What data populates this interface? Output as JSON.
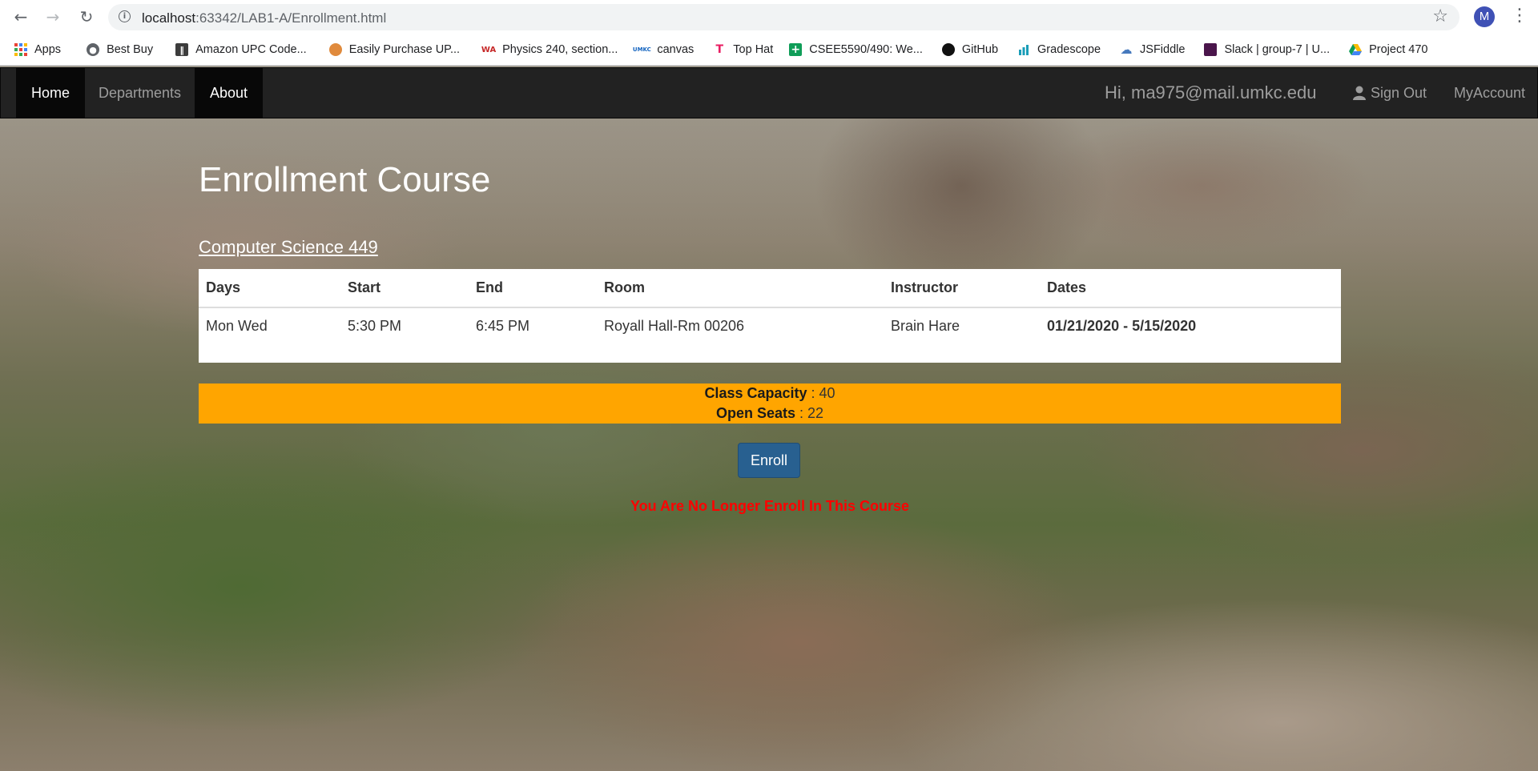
{
  "browser": {
    "url_host": "localhost",
    "url_rest": ":63342/LAB1-A/Enrollment.html",
    "profile_initial": "M",
    "bookmarks": [
      {
        "label": "Apps",
        "icon": "apps-grid-icon"
      },
      {
        "label": "Best Buy",
        "icon": "globe-icon"
      },
      {
        "label": "Amazon UPC Code...",
        "icon": "barcode-icon"
      },
      {
        "label": "Easily Purchase UP...",
        "icon": "upc-logo-icon"
      },
      {
        "label": "Physics 240, section...",
        "icon": "webassign-icon",
        "icon_text": "WA"
      },
      {
        "label": "canvas",
        "icon": "umkc-icon",
        "icon_text": "UMKC"
      },
      {
        "label": "Top Hat",
        "icon": "tophat-icon",
        "icon_text": "T"
      },
      {
        "label": "CSEE5590/490: We...",
        "icon": "sheets-icon",
        "icon_text": "+"
      },
      {
        "label": "GitHub",
        "icon": "github-icon"
      },
      {
        "label": "Gradescope",
        "icon": "gradescope-icon"
      },
      {
        "label": "JSFiddle",
        "icon": "jsfiddle-icon"
      },
      {
        "label": "Slack | group-7 | U...",
        "icon": "slack-icon"
      },
      {
        "label": "Project 470",
        "icon": "google-drive-icon"
      }
    ]
  },
  "navbar": {
    "home": "Home",
    "departments": "Departments",
    "about": "About",
    "greeting": "Hi, ma975@mail.umkc.edu",
    "sign_out": "Sign Out",
    "my_account": "MyAccount"
  },
  "main": {
    "title": "Enrollment Course",
    "course_name": "Computer Science 449",
    "table": {
      "headers": [
        "Days",
        "Start",
        "End",
        "Room",
        "Instructor",
        "Dates"
      ],
      "row": [
        "Mon Wed",
        "5:30 PM",
        "6:45 PM",
        "Royall Hall-Rm 00206",
        "Brain Hare",
        "01/21/2020 - 5/15/2020"
      ]
    },
    "capacity_label": "Class Capacity",
    "capacity_value": " : 40",
    "open_seats_label": "Open Seats",
    "open_seats_value": " : 22",
    "enroll_button": "Enroll",
    "status_message": "You Are No Longer Enroll In This Course"
  },
  "colors": {
    "navbar_bg": "#222222",
    "capacity_bg": "#ffa500",
    "enroll_button_bg": "#286090",
    "status_text": "#ff0000"
  }
}
